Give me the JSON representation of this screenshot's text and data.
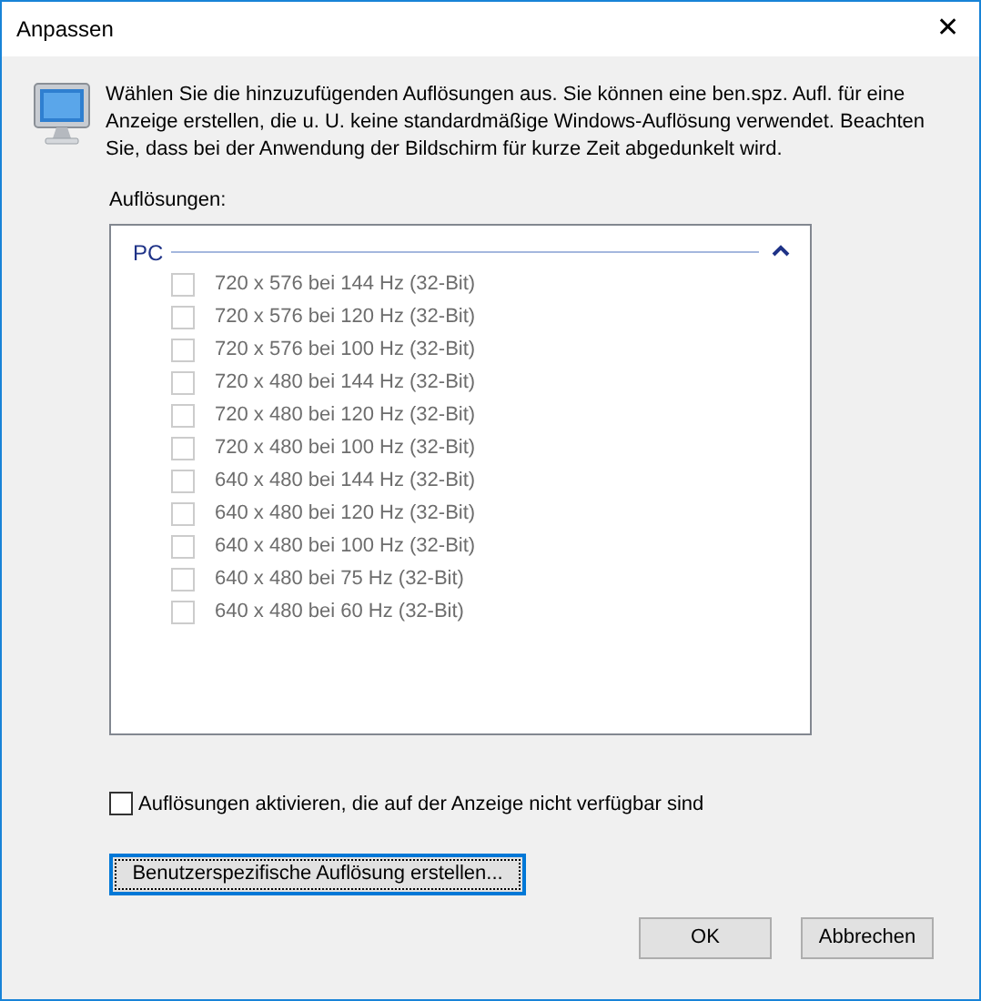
{
  "window": {
    "title": "Anpassen",
    "close": "✕"
  },
  "description": "Wählen Sie die hinzuzufügenden Auflösungen aus. Sie können eine ben.spz. Aufl. für eine Anzeige erstellen, die u. U. keine standardmäßige Windows-Auflösung verwendet. Beachten Sie, dass bei der Anwendung der Bildschirm für kurze Zeit abgedunkelt wird.",
  "list_label": "Auflösungen:",
  "group": {
    "label": "PC",
    "expanded": true,
    "items": [
      {
        "label": "720 x 576 bei 144 Hz (32-Bit)",
        "checked": false,
        "disabled": true
      },
      {
        "label": "720 x 576 bei 120 Hz (32-Bit)",
        "checked": false,
        "disabled": true
      },
      {
        "label": "720 x 576 bei 100 Hz (32-Bit)",
        "checked": false,
        "disabled": true
      },
      {
        "label": "720 x 480 bei 144 Hz (32-Bit)",
        "checked": false,
        "disabled": true
      },
      {
        "label": "720 x 480 bei 120 Hz (32-Bit)",
        "checked": false,
        "disabled": true
      },
      {
        "label": "720 x 480 bei 100 Hz (32-Bit)",
        "checked": false,
        "disabled": true
      },
      {
        "label": "640 x 480 bei 144 Hz (32-Bit)",
        "checked": false,
        "disabled": true
      },
      {
        "label": "640 x 480 bei 120 Hz (32-Bit)",
        "checked": false,
        "disabled": true
      },
      {
        "label": "640 x 480 bei 100 Hz (32-Bit)",
        "checked": false,
        "disabled": true
      },
      {
        "label": "640 x 480 bei 75 Hz (32-Bit)",
        "checked": false,
        "disabled": true
      },
      {
        "label": "640 x 480 bei 60 Hz (32-Bit)",
        "checked": false,
        "disabled": true
      }
    ]
  },
  "enable_unavailable": {
    "label": "Auflösungen aktivieren, die auf der Anzeige nicht verfügbar sind",
    "checked": false
  },
  "custom_button": "Benutzerspezifische Auflösung erstellen...",
  "buttons": [
    "OK",
    "Abbrechen"
  ]
}
